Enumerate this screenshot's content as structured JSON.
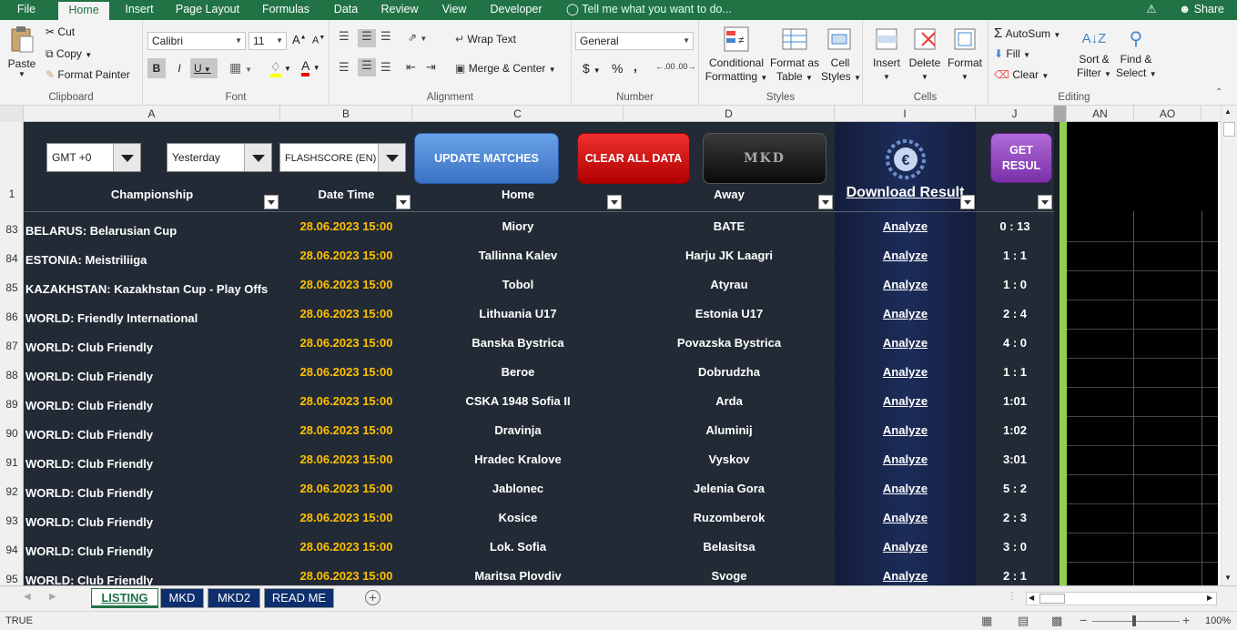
{
  "ribbon_tabs": [
    "File",
    "Home",
    "Insert",
    "Page Layout",
    "Formulas",
    "Data",
    "Review",
    "View",
    "Developer"
  ],
  "tell_me": "Tell me what you want to do...",
  "share": "Share",
  "clipboard": {
    "paste": "Paste",
    "cut": "Cut",
    "copy": "Copy",
    "format_painter": "Format Painter",
    "label": "Clipboard"
  },
  "font": {
    "name": "Calibri",
    "size": "11",
    "bold": "B",
    "italic": "I",
    "underline": "U",
    "label": "Font"
  },
  "alignment": {
    "wrap": "Wrap Text",
    "merge": "Merge & Center",
    "label": "Alignment"
  },
  "number": {
    "format": "General",
    "currency": "$",
    "percent": "%",
    "comma": ",",
    "label": "Number"
  },
  "styles": {
    "cond": "Conditional",
    "cond2": "Formatting",
    "fmt_table": "Format as",
    "fmt_table2": "Table",
    "cell_styles": "Cell",
    "cell_styles2": "Styles",
    "label": "Styles"
  },
  "cells": {
    "insert": "Insert",
    "delete": "Delete",
    "format": "Format",
    "label": "Cells"
  },
  "editing": {
    "autosum": "AutoSum",
    "fill": "Fill",
    "clear": "Clear",
    "sort": "Sort &",
    "sort2": "Filter",
    "find": "Find &",
    "find2": "Select",
    "label": "Editing"
  },
  "columns": [
    "A",
    "B",
    "C",
    "D",
    "I",
    "J",
    "AN",
    "AO"
  ],
  "controls": {
    "gmt": "GMT +0",
    "day": "Yesterday",
    "source": "FLASHSCORE (EN)",
    "update": "UPDATE MATCHES",
    "clear": "CLEAR ALL DATA",
    "mkd": "MKD",
    "get1": "GET",
    "get2": "RESUL"
  },
  "headers": {
    "championship": "Championship",
    "datetime": "Date Time",
    "home": "Home",
    "away": "Away",
    "download": "Download Result"
  },
  "header_row": "1",
  "rows": [
    {
      "n": "83",
      "champ": "BELARUS: Belarusian Cup",
      "dt": "28.06.2023 15:00",
      "home": "Miory",
      "away": "BATE",
      "an": "Analyze",
      "res": "0 : 13"
    },
    {
      "n": "84",
      "champ": "ESTONIA: Meistriliiga",
      "dt": "28.06.2023 15:00",
      "home": "Tallinna Kalev",
      "away": "Harju JK Laagri",
      "an": "Analyze",
      "res": "1 : 1"
    },
    {
      "n": "85",
      "champ": "KAZAKHSTAN: Kazakhstan Cup - Play Offs",
      "dt": "28.06.2023 15:00",
      "home": "Tobol",
      "away": "Atyrau",
      "an": "Analyze",
      "res": "1 : 0"
    },
    {
      "n": "86",
      "champ": "WORLD: Friendly International",
      "dt": "28.06.2023 15:00",
      "home": "Lithuania U17",
      "away": "Estonia U17",
      "an": "Analyze",
      "res": "2 : 4"
    },
    {
      "n": "87",
      "champ": "WORLD: Club Friendly",
      "dt": "28.06.2023 15:00",
      "home": "Banska Bystrica",
      "away": "Povazska Bystrica",
      "an": "Analyze",
      "res": "4 : 0"
    },
    {
      "n": "88",
      "champ": "WORLD: Club Friendly",
      "dt": "28.06.2023 15:00",
      "home": "Beroe",
      "away": "Dobrudzha",
      "an": "Analyze",
      "res": "1 : 1"
    },
    {
      "n": "89",
      "champ": "WORLD: Club Friendly",
      "dt": "28.06.2023 15:00",
      "home": "CSKA 1948 Sofia II",
      "away": "Arda",
      "an": "Analyze",
      "res": "1:01"
    },
    {
      "n": "90",
      "champ": "WORLD: Club Friendly",
      "dt": "28.06.2023 15:00",
      "home": "Dravinja",
      "away": "Aluminij",
      "an": "Analyze",
      "res": "1:02"
    },
    {
      "n": "91",
      "champ": "WORLD: Club Friendly",
      "dt": "28.06.2023 15:00",
      "home": "Hradec Kralove",
      "away": "Vyskov",
      "an": "Analyze",
      "res": "3:01"
    },
    {
      "n": "92",
      "champ": "WORLD: Club Friendly",
      "dt": "28.06.2023 15:00",
      "home": "Jablonec",
      "away": "Jelenia Gora",
      "an": "Analyze",
      "res": "5 : 2"
    },
    {
      "n": "93",
      "champ": "WORLD: Club Friendly",
      "dt": "28.06.2023 15:00",
      "home": "Kosice",
      "away": "Ruzomberok",
      "an": "Analyze",
      "res": "2 : 3"
    },
    {
      "n": "94",
      "champ": "WORLD: Club Friendly",
      "dt": "28.06.2023 15:00",
      "home": "Lok. Sofia",
      "away": "Belasitsa",
      "an": "Analyze",
      "res": "3 : 0"
    },
    {
      "n": "95",
      "champ": "WORLD: Club Friendly",
      "dt": "28.06.2023 15:00",
      "home": "Maritsa Plovdiv",
      "away": "Svoge",
      "an": "Analyze",
      "res": "2 : 1"
    }
  ],
  "sheet_tabs": [
    "LISTING",
    "MKD",
    "MKD2",
    "READ ME"
  ],
  "status": {
    "mode": "TRUE",
    "zoom": "100%"
  }
}
